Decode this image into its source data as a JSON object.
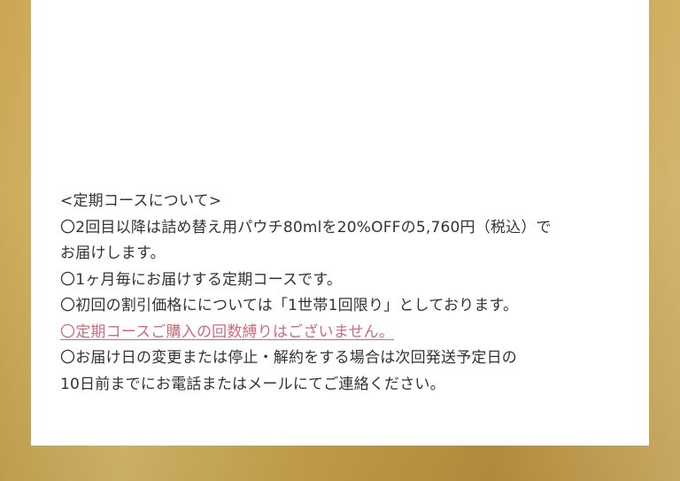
{
  "colors": {
    "frame_gold": "#c9a24c",
    "panel_background": "#ffffff",
    "body_text": "#333333",
    "notice_text": "#d06a78"
  },
  "course_info": {
    "heading": "<定期コースについて>",
    "line_1": "〇2回目以降は詰め替え用パウチ80mlを20%OFFの5,760円（税込）で",
    "line_2": "お届けします。",
    "line_3": "〇1ヶ月毎にお届けする定期コースです。",
    "line_4": "〇初回の割引価格ににつ いては「1世帯1回限り」としております。",
    "notice": "〇定期コースご購入の回数縛りはございません。",
    "line_5": "〇お届け日の変更または停止・解約をする場合は次回発送予定日の",
    "line_6": "10日前までにお電話またはメールにてご連絡ください。"
  }
}
